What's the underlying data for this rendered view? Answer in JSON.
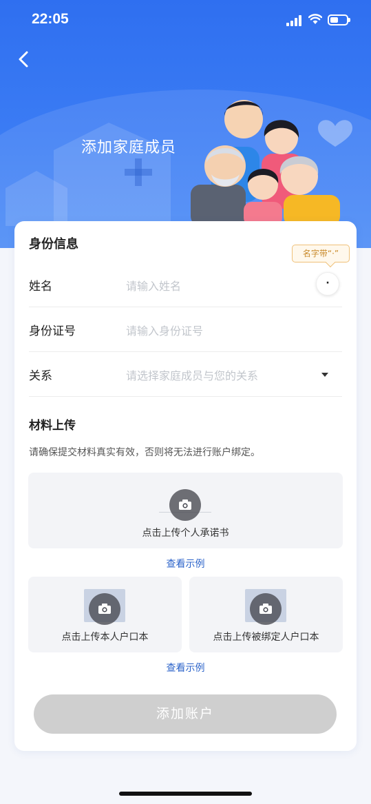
{
  "status": {
    "time": "22:05"
  },
  "header": {
    "title": "添加家庭成员"
  },
  "identity": {
    "section_title": "身份信息",
    "name_label": "姓名",
    "name_placeholder": "请输入姓名",
    "tooltip": "名字带“·”",
    "dot_button": "·",
    "id_label": "身份证号",
    "id_placeholder": "请输入身份证号",
    "relation_label": "关系",
    "relation_placeholder": "请选择家庭成员与您的关系"
  },
  "materials": {
    "section_title": "材料上传",
    "notice": "请确保提交材料真实有效，否则将无法进行账户绑定。",
    "commitment_label": "点击上传个人承诺书",
    "example_1": "查看示例",
    "own_hukou_label": "点击上传本人户口本",
    "bound_hukou_label": "点击上传被绑定人户口本",
    "example_2": "查看示例"
  },
  "submit_label": "添加账户",
  "colors": {
    "primary": "#3b7cf4",
    "link": "#2a62c9",
    "disabled": "#cfcfcf",
    "tooltip": "#c98a2b"
  }
}
